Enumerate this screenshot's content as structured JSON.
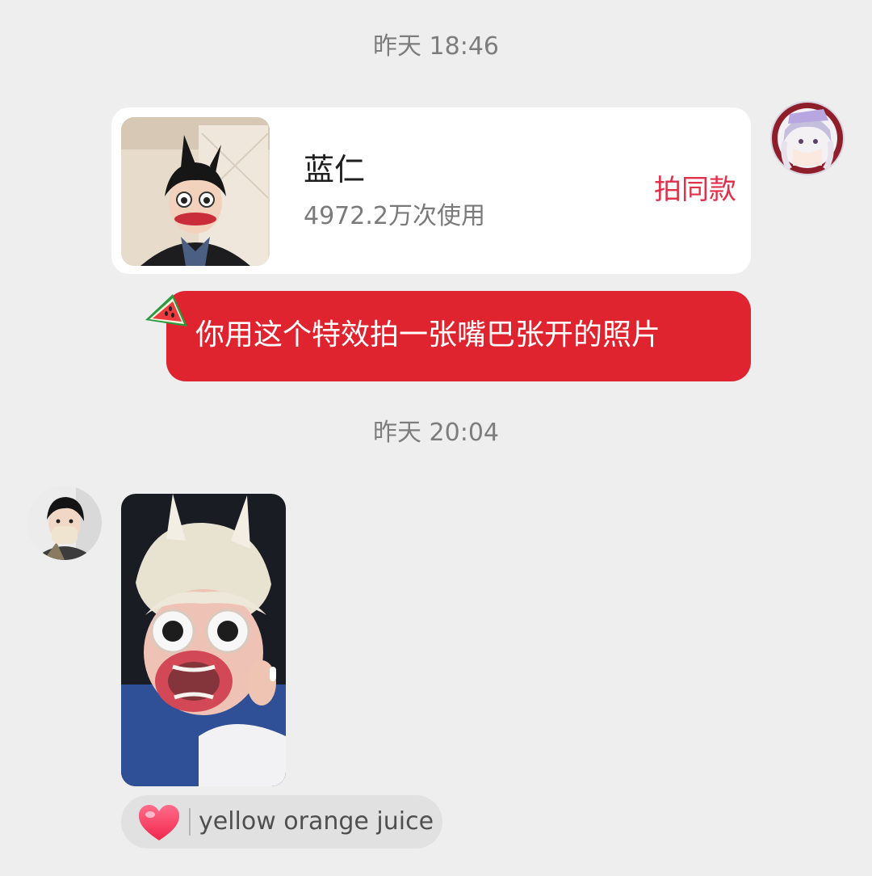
{
  "chat": {
    "timestamp_1": "昨天 18:46",
    "timestamp_2": "昨天 20:04",
    "effect_card": {
      "name": "蓝仁",
      "usage": "4972.2万次使用",
      "action_label": "拍同款"
    },
    "sent_message": "你用这个特效拍一张嘴巴张开的照片",
    "reaction": {
      "icon": "heart-icon",
      "user": "yellow orange juice"
    }
  },
  "colors": {
    "background": "#eeeeee",
    "sent_bubble": "#e0242f",
    "action": "#e0304a",
    "reaction_chip": "#e1e1e1"
  }
}
